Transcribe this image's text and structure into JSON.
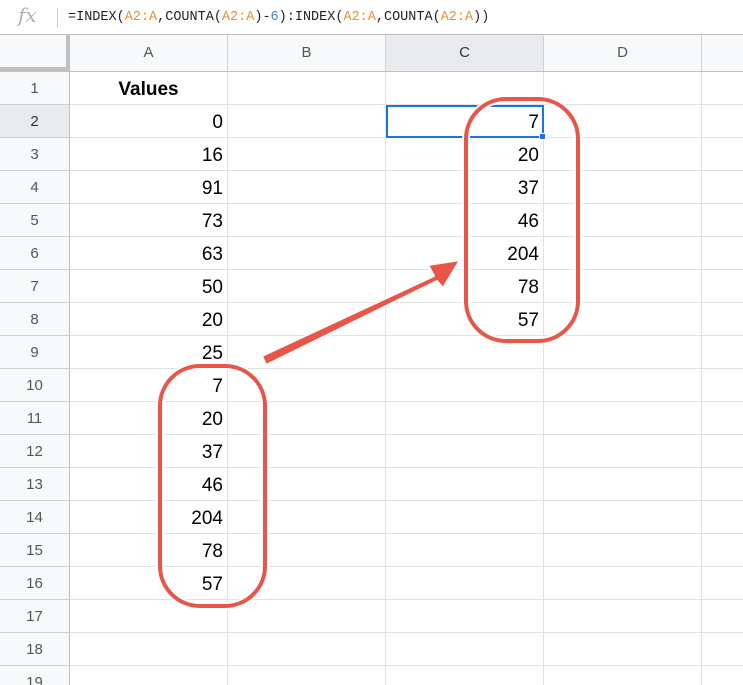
{
  "formula_bar": {
    "fx_label": "fx",
    "formula_parts": [
      {
        "text": "=INDEX(",
        "kind": "plain"
      },
      {
        "text": "A2:A",
        "kind": "ref"
      },
      {
        "text": ",COUNTA(",
        "kind": "plain"
      },
      {
        "text": "A2:A",
        "kind": "ref"
      },
      {
        "text": ")-",
        "kind": "plain"
      },
      {
        "text": "6",
        "kind": "num"
      },
      {
        "text": "):INDEX(",
        "kind": "plain"
      },
      {
        "text": "A2:A",
        "kind": "ref"
      },
      {
        "text": ",COUNTA(",
        "kind": "plain"
      },
      {
        "text": "A2:A",
        "kind": "ref"
      },
      {
        "text": "))",
        "kind": "plain"
      }
    ]
  },
  "columns": [
    "A",
    "B",
    "C",
    "D"
  ],
  "active_column": "C",
  "active_row": 2,
  "rows": [
    {
      "n": "1",
      "a": "Values",
      "c": ""
    },
    {
      "n": "2",
      "a": "0",
      "c": "7"
    },
    {
      "n": "3",
      "a": "16",
      "c": "20"
    },
    {
      "n": "4",
      "a": "91",
      "c": "37"
    },
    {
      "n": "5",
      "a": "73",
      "c": "46"
    },
    {
      "n": "6",
      "a": "63",
      "c": "204"
    },
    {
      "n": "7",
      "a": "50",
      "c": "78"
    },
    {
      "n": "8",
      "a": "20",
      "c": "57"
    },
    {
      "n": "9",
      "a": "25",
      "c": ""
    },
    {
      "n": "10",
      "a": "7",
      "c": ""
    },
    {
      "n": "11",
      "a": "20",
      "c": ""
    },
    {
      "n": "12",
      "a": "37",
      "c": ""
    },
    {
      "n": "13",
      "a": "46",
      "c": ""
    },
    {
      "n": "14",
      "a": "204",
      "c": ""
    },
    {
      "n": "15",
      "a": "78",
      "c": ""
    },
    {
      "n": "16",
      "a": "57",
      "c": ""
    },
    {
      "n": "17",
      "a": "",
      "c": ""
    },
    {
      "n": "18",
      "a": "",
      "c": ""
    },
    {
      "n": "19",
      "a": "",
      "c": ""
    }
  ],
  "colors": {
    "annotation": "#e8564a",
    "selection": "#1a73e8",
    "cell_ref": "#e69138",
    "number_literal": "#3d85c6"
  }
}
